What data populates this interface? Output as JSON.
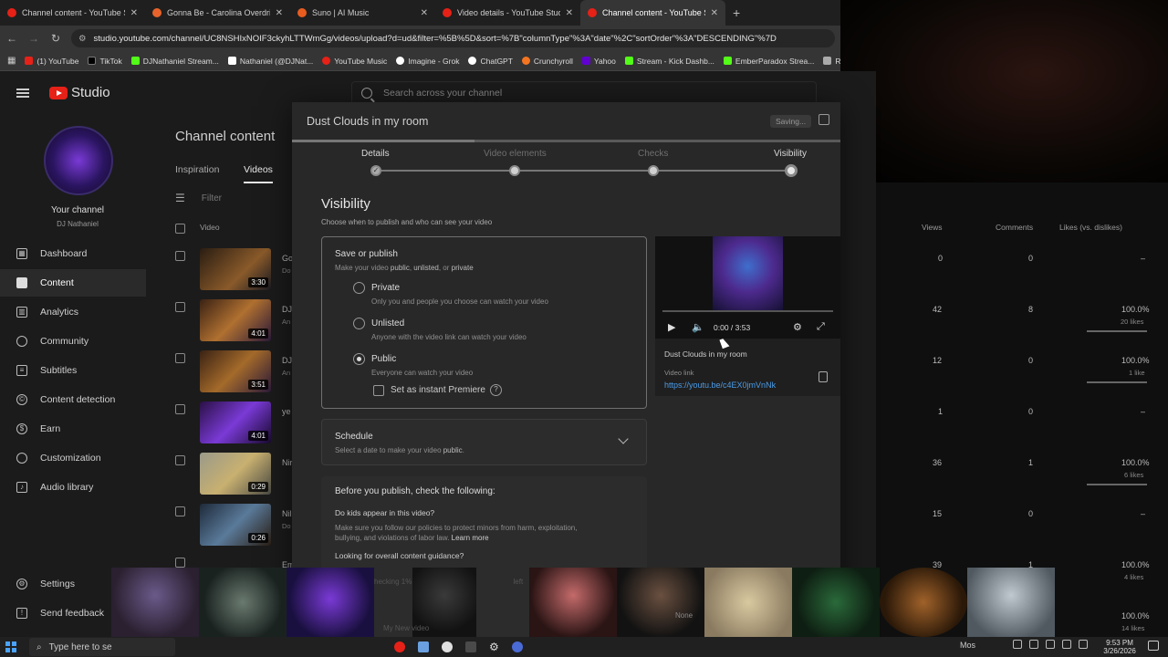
{
  "browser": {
    "tabs": [
      {
        "title": "Channel content - YouTube Stu",
        "color": "#e62117"
      },
      {
        "title": "Gonna Be - Carolina Overdrive",
        "color": "#e8632b"
      },
      {
        "title": "Suno | AI Music",
        "color": "#e85d1f"
      },
      {
        "title": "Video details - YouTube Studio",
        "color": "#e62117"
      },
      {
        "title": "Channel content - YouTube Stu",
        "color": "#e62117",
        "active": true
      }
    ],
    "url": "studio.youtube.com/channel/UC8NSHIxNOIF3ckyhLTTWmGg/videos/upload?d=ud&filter=%5B%5D&sort=%7B\"columnType\"%3A\"date\"%2C\"sortOrder\"%3A\"DESCENDING\"%7D",
    "bookmarks": [
      {
        "label": "(1) YouTube",
        "color": "#e62117"
      },
      {
        "label": "TikTok",
        "color": "#000000"
      },
      {
        "label": "DJNathaniel Stream...",
        "color": "#53fc18"
      },
      {
        "label": "Nathaniel (@DJNat...",
        "color": "#ffffff"
      },
      {
        "label": "YouTube Music",
        "color": "#e62117"
      },
      {
        "label": "Imagine - Grok",
        "color": "#ffffff"
      },
      {
        "label": "ChatGPT",
        "color": "#ffffff"
      },
      {
        "label": "Crunchyroll",
        "color": "#f47521"
      },
      {
        "label": "Yahoo",
        "color": "#6001d2"
      },
      {
        "label": "Stream - Kick Dashb...",
        "color": "#53fc18"
      },
      {
        "label": "EmberParadox Strea...",
        "color": "#53fc18"
      },
      {
        "label": "Run",
        "color": "#aaaaaa"
      }
    ]
  },
  "studio": {
    "logo_text": "Studio",
    "search_placeholder": "Search across your channel",
    "channel": {
      "label": "Your channel",
      "name": "DJ Nathaniel"
    },
    "nav": [
      {
        "label": "Dashboard",
        "icon": "dashboard-icon"
      },
      {
        "label": "Content",
        "icon": "content-icon",
        "selected": true
      },
      {
        "label": "Analytics",
        "icon": "analytics-icon"
      },
      {
        "label": "Community",
        "icon": "community-icon"
      },
      {
        "label": "Subtitles",
        "icon": "subtitles-icon"
      },
      {
        "label": "Content detection",
        "icon": "copyright-icon"
      },
      {
        "label": "Earn",
        "icon": "earn-icon"
      },
      {
        "label": "Customization",
        "icon": "customization-icon"
      },
      {
        "label": "Audio library",
        "icon": "audio-library-icon"
      },
      {
        "label": "Settings",
        "icon": "gear-icon"
      },
      {
        "label": "Send feedback",
        "icon": "feedback-icon"
      }
    ],
    "page_title": "Channel content",
    "tabs": [
      "Inspiration",
      "Videos"
    ],
    "filter_placeholder": "Filter",
    "columns": {
      "video": "Video",
      "views": "Views",
      "comments": "Comments",
      "likes": "Likes (vs. dislikes)"
    },
    "rows": [
      {
        "duration": "3:30",
        "title": "Go",
        "desc": "Do",
        "views": "0",
        "comments": "0",
        "likes": "–",
        "likes_sub": ""
      },
      {
        "duration": "4:01",
        "title": "DJ",
        "desc": "An",
        "views": "42",
        "comments": "8",
        "likes": "100.0%",
        "likes_sub": "20 likes"
      },
      {
        "duration": "3:51",
        "title": "DJ",
        "desc": "An",
        "views": "12",
        "comments": "0",
        "likes": "100.0%",
        "likes_sub": "1 like"
      },
      {
        "duration": "4:01",
        "title": "ye",
        "desc": "",
        "views": "1",
        "comments": "0",
        "likes": "–",
        "likes_sub": ""
      },
      {
        "duration": "0:29",
        "title": "Nir",
        "desc": "",
        "views": "36",
        "comments": "1",
        "likes": "100.0%",
        "likes_sub": "6 likes"
      },
      {
        "duration": "0:26",
        "title": "Nil",
        "desc": "Do",
        "views": "15",
        "comments": "0",
        "likes": "–",
        "likes_sub": ""
      },
      {
        "duration": "",
        "title": "Em",
        "desc": "",
        "views": "39",
        "comments": "1",
        "likes": "100.0%",
        "likes_sub": "4 likes"
      },
      {
        "duration": "",
        "title": "",
        "desc": "",
        "views": "",
        "comments": "",
        "likes": "100.0%",
        "likes_sub": "14 likes"
      }
    ]
  },
  "dialog": {
    "title": "Dust Clouds in my room",
    "saving": "Saving...",
    "steps": [
      "Details",
      "Video elements",
      "Checks",
      "Visibility"
    ],
    "visibility_title": "Visibility",
    "visibility_sub": "Choose when to publish and who can see your video",
    "save_or_publish": {
      "title": "Save or publish",
      "sub_prefix": "Make your video ",
      "sub_public": "public",
      "sub_sep1": ", ",
      "sub_unlisted": "unlisted",
      "sub_sep2": ", or ",
      "sub_private": "private",
      "options": [
        {
          "label": "Private",
          "desc": "Only you and people you choose can watch your video"
        },
        {
          "label": "Unlisted",
          "desc": "Anyone with the video link can watch your video"
        },
        {
          "label": "Public",
          "desc": "Everyone can watch your video",
          "selected": true
        }
      ],
      "premiere": "Set as instant Premiere",
      "premiere_help": "?"
    },
    "schedule": {
      "title": "Schedule",
      "sub_prefix": "Select a date to make your video ",
      "sub_bold": "public",
      "sub_suffix": "."
    },
    "before": {
      "title": "Before you publish, check the following:",
      "q1": "Do kids appear in this video?",
      "t1": "Make sure you follow our policies to protect minors from harm, exploitation, bullying, and violations of labor law. ",
      "t1_link": "Learn more",
      "q2": "Looking for overall content guidance?"
    },
    "footer_faint": "hecking 1% ... 10 m",
    "footer_faint2": "left",
    "preview": {
      "time": "0:00 / 3:53",
      "video_title": "Dust Clouds in my room",
      "link_label": "Video link",
      "link": "https://youtu.be/c4EX0jmVnNk"
    }
  },
  "overlay": {
    "faint1": "My New video",
    "faint2": "None"
  },
  "taskbar": {
    "search_placeholder": "Type here to se",
    "tray_text": "Mos",
    "time": "9:53 PM",
    "date": "3/26/2026"
  }
}
